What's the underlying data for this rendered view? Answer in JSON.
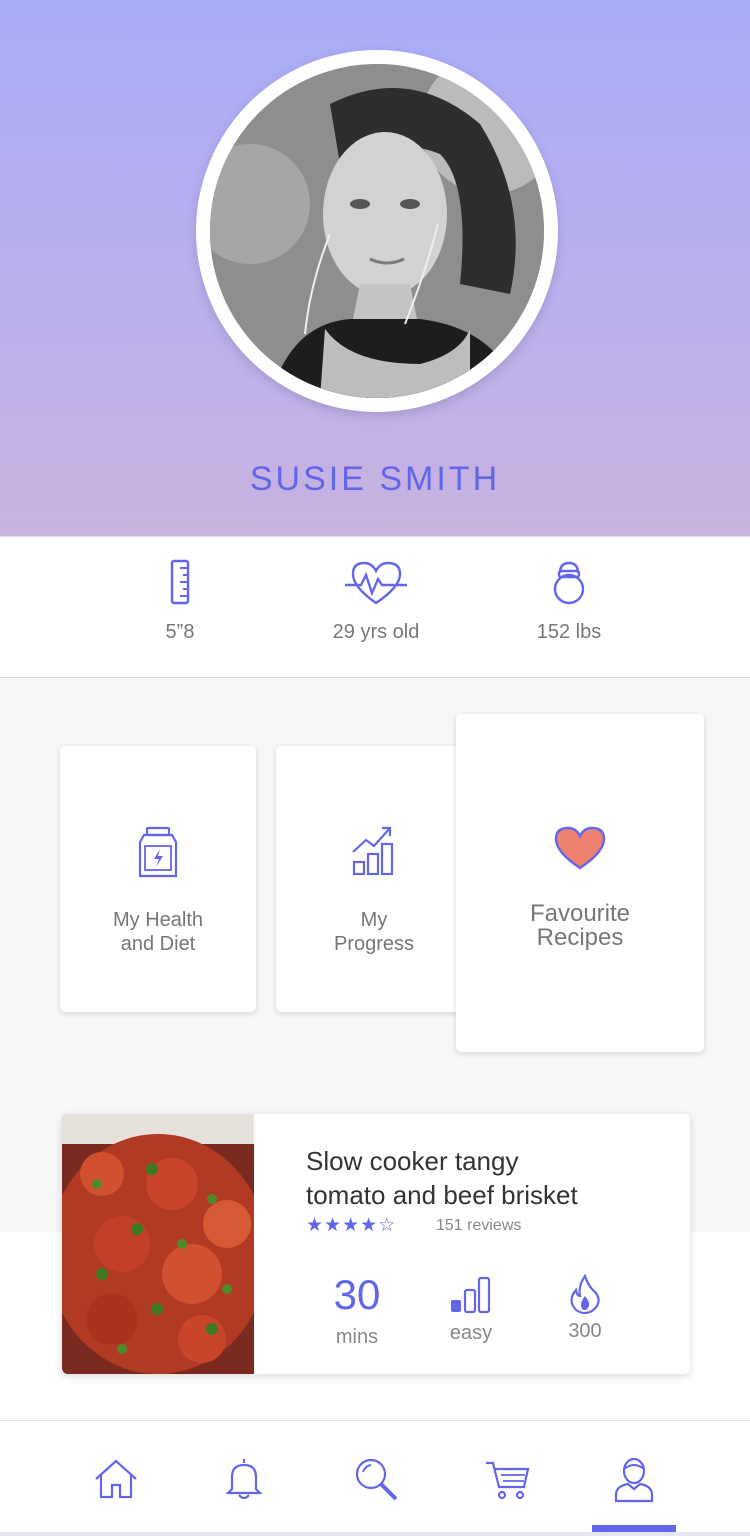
{
  "profile": {
    "name": "SUSIE SMITH"
  },
  "stats": {
    "height": "5”8",
    "age": "29 yrs old",
    "weight": "152 lbs"
  },
  "menu": {
    "health": "My Health\nand Diet",
    "progress": "My\nProgress",
    "recipes": "Favourite\nRecipes"
  },
  "recipe": {
    "title": "Slow cooker tangy\ntomato and beef brisket",
    "rating": 4,
    "rating_max": 5,
    "reviews": "151 reviews",
    "time_value": "30",
    "time_unit": "mins",
    "difficulty": "easy",
    "calories": "300"
  },
  "nav": {
    "items": [
      "home-icon",
      "bell-icon",
      "search-icon",
      "cart-icon",
      "profile-icon"
    ],
    "active": "profile-icon"
  },
  "colors": {
    "accent": "#6366e8",
    "header_top": "#a8acf8",
    "header_bottom": "#c9b3e0",
    "heart": "#f08070"
  }
}
